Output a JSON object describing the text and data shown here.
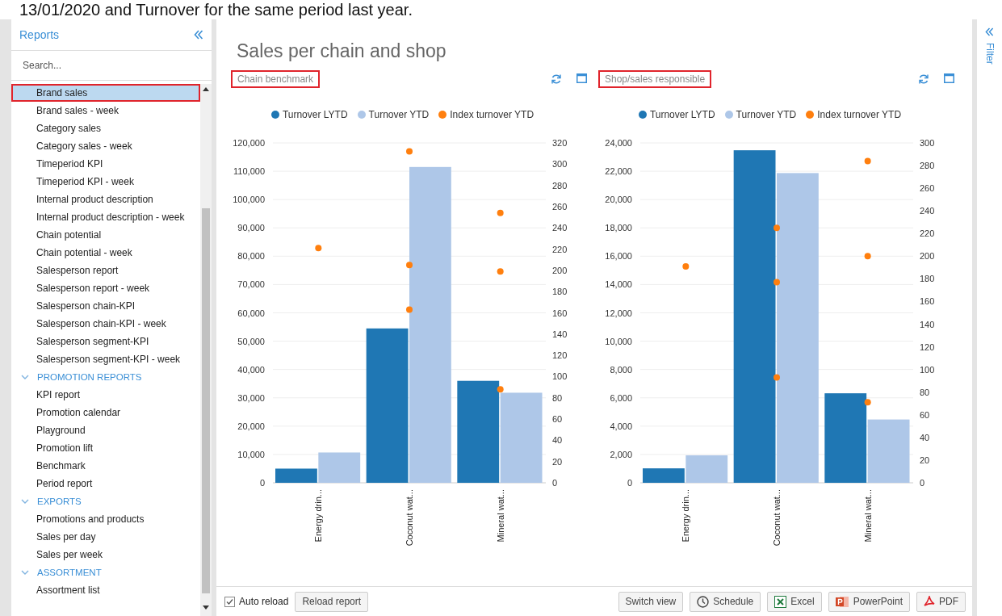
{
  "caption": "13/01/2020 and Turnover for the same period last year.",
  "sidebar": {
    "title": "Reports",
    "search": {
      "placeholder": "Search..."
    },
    "items": [
      {
        "label": "Brand sales",
        "selected": true
      },
      {
        "label": "Brand sales - week",
        "selected": false
      },
      {
        "label": "Category sales",
        "selected": false
      },
      {
        "label": "Category sales - week",
        "selected": false
      },
      {
        "label": "Timeperiod KPI",
        "selected": false
      },
      {
        "label": "Timeperiod KPI - week",
        "selected": false
      },
      {
        "label": "Internal product description",
        "selected": false
      },
      {
        "label": "Internal product description - week",
        "selected": false
      },
      {
        "label": "Chain potential",
        "selected": false
      },
      {
        "label": "Chain potential - week",
        "selected": false
      },
      {
        "label": "Salesperson report",
        "selected": false
      },
      {
        "label": "Salesperson report - week",
        "selected": false
      },
      {
        "label": "Salesperson chain-KPI",
        "selected": false
      },
      {
        "label": "Salesperson chain-KPI - week",
        "selected": false
      },
      {
        "label": "Salesperson segment-KPI",
        "selected": false
      },
      {
        "label": "Salesperson segment-KPI - week",
        "selected": false
      }
    ],
    "sections": [
      {
        "label": "PROMOTION REPORTS",
        "expanded": true,
        "children": [
          {
            "label": "KPI report",
            "selected": false
          },
          {
            "label": "Promotion calendar",
            "selected": false
          },
          {
            "label": "Playground",
            "selected": false
          },
          {
            "label": "Promotion lift",
            "selected": false
          },
          {
            "label": "Benchmark",
            "selected": false
          },
          {
            "label": "Period report",
            "selected": false
          }
        ]
      },
      {
        "label": "EXPORTS",
        "expanded": true,
        "children": [
          {
            "label": "Promotions and products",
            "selected": false
          },
          {
            "label": "Sales per day",
            "selected": false
          },
          {
            "label": "Sales per week",
            "selected": false
          }
        ]
      },
      {
        "label": "ASSORTMENT",
        "expanded": true,
        "children": [
          {
            "label": "Assortment list",
            "selected": false
          }
        ]
      }
    ]
  },
  "main": {
    "title": "Sales per chain and shop",
    "charts": [
      {
        "title": "Chain benchmark",
        "chart_data": {
          "type": "bar",
          "categories": [
            "Energy drin...",
            "Coconut wat...",
            "Mineral wat..."
          ],
          "series": [
            {
              "name": "Turnover LYTD",
              "color": "#1f77b4",
              "type": "bar",
              "values": [
                5000,
                54500,
                36000
              ]
            },
            {
              "name": "Turnover YTD",
              "color": "#aec7e8",
              "type": "bar",
              "values": [
                10700,
                111500,
                31800
              ]
            },
            {
              "name": "Index turnover YTD",
              "color": "#ff7f0e",
              "type": "scatter",
              "axis": "y2",
              "values": [
                221,
                312,
                254
              ]
            },
            {
              "color": "#ff7f0e",
              "type": "scatter",
              "axis": "y2",
              "values": [
                null,
                205,
                199
              ]
            },
            {
              "color": "#ff7f0e",
              "type": "scatter",
              "axis": "y2",
              "values": [
                null,
                163,
                88
              ]
            }
          ],
          "grid": true,
          "legend": "top",
          "ylim": [
            0,
            120000
          ],
          "yticks": [
            {
              "value": 0,
              "label": "0"
            },
            {
              "value": 10000,
              "label": "10,000"
            },
            {
              "value": 20000,
              "label": "20,000"
            },
            {
              "value": 30000,
              "label": "30,000"
            },
            {
              "value": 40000,
              "label": "40,000"
            },
            {
              "value": 50000,
              "label": "50,000"
            },
            {
              "value": 60000,
              "label": "60,000"
            },
            {
              "value": 70000,
              "label": "70,000"
            },
            {
              "value": 80000,
              "label": "80,000"
            },
            {
              "value": 90000,
              "label": "90,000"
            },
            {
              "value": 100000,
              "label": "100,000"
            },
            {
              "value": 110000,
              "label": "110,000"
            },
            {
              "value": 120000,
              "label": "120,000"
            }
          ],
          "y2lim": [
            0,
            320
          ],
          "y2ticks": [
            0,
            20,
            40,
            60,
            80,
            100,
            120,
            140,
            160,
            180,
            200,
            220,
            240,
            260,
            280,
            300,
            320
          ]
        }
      },
      {
        "title": "Shop/sales responsible",
        "chart_data": {
          "type": "bar",
          "categories": [
            "Energy drin...",
            "Coconut wat...",
            "Mineral wat..."
          ],
          "series": [
            {
              "name": "Turnover LYTD",
              "color": "#1f77b4",
              "type": "bar",
              "values": [
                1020,
                23480,
                6320
              ]
            },
            {
              "name": "Turnover YTD",
              "color": "#aec7e8",
              "type": "bar",
              "values": [
                1940,
                21870,
                4470
              ]
            },
            {
              "name": "Index turnover YTD",
              "color": "#ff7f0e",
              "type": "scatter",
              "axis": "y2",
              "values": [
                191,
                225,
                284
              ]
            },
            {
              "color": "#ff7f0e",
              "type": "scatter",
              "axis": "y2",
              "values": [
                null,
                177,
                200
              ]
            },
            {
              "color": "#ff7f0e",
              "type": "scatter",
              "axis": "y2",
              "values": [
                null,
                93,
                71
              ]
            }
          ],
          "grid": true,
          "legend": "top",
          "ylim": [
            0,
            24000
          ],
          "yticks": [
            {
              "value": 0,
              "label": "0"
            },
            {
              "value": 2000,
              "label": "2,000"
            },
            {
              "value": 4000,
              "label": "4,000"
            },
            {
              "value": 6000,
              "label": "6,000"
            },
            {
              "value": 8000,
              "label": "8,000"
            },
            {
              "value": 10000,
              "label": "10,000"
            },
            {
              "value": 12000,
              "label": "12,000"
            },
            {
              "value": 14000,
              "label": "14,000"
            },
            {
              "value": 16000,
              "label": "16,000"
            },
            {
              "value": 18000,
              "label": "18,000"
            },
            {
              "value": 20000,
              "label": "20,000"
            },
            {
              "value": 22000,
              "label": "22,000"
            },
            {
              "value": 24000,
              "label": "24,000"
            }
          ],
          "y2lim": [
            0,
            300
          ],
          "y2ticks": [
            0,
            20,
            40,
            60,
            80,
            100,
            120,
            140,
            160,
            180,
            200,
            220,
            240,
            260,
            280,
            300
          ]
        }
      }
    ]
  },
  "toolbar": {
    "auto_reload": {
      "label": "Auto reload",
      "checked": true
    },
    "left_buttons": [
      "Reload report"
    ],
    "right_buttons": [
      {
        "kind": "plain",
        "label": "Switch view"
      },
      {
        "kind": "clock",
        "label": "Schedule"
      },
      {
        "kind": "excel",
        "label": "Excel"
      },
      {
        "kind": "powerpoint",
        "label": "PowerPoint"
      },
      {
        "kind": "pdf",
        "label": "PDF"
      }
    ]
  },
  "filter_panel": {
    "label": "Filter"
  }
}
